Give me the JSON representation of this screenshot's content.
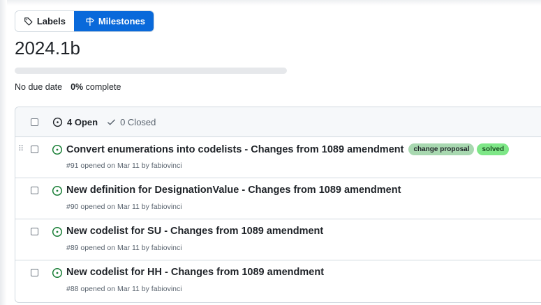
{
  "tabs": {
    "labels": "Labels",
    "milestones": "Milestones"
  },
  "milestone": {
    "title": "2024.1b",
    "due": "No due date",
    "percent": "0%",
    "complete_label": "complete",
    "progress_fraction": 0
  },
  "issues_header": {
    "open": "4 Open",
    "closed": "0 Closed"
  },
  "issues": [
    {
      "title": "Convert enumerations into codelists - Changes from 1089 amendment",
      "meta": "#91 opened on Mar 11 by fabiovinci",
      "labels": [
        {
          "name": "change proposal",
          "bg": "#a8d8b0",
          "fg": "#1f2328"
        },
        {
          "name": "solved",
          "bg": "#7ee787",
          "fg": "#1a4d21"
        }
      ]
    },
    {
      "title": "New definition for DesignationValue - Changes from 1089 amendment",
      "meta": "#90 opened on Mar 11 by fabiovinci",
      "labels": []
    },
    {
      "title": "New codelist for SU - Changes from 1089 amendment",
      "meta": "#89 opened on Mar 11 by fabiovinci",
      "labels": []
    },
    {
      "title": "New codelist for HH - Changes from 1089 amendment",
      "meta": "#88 opened on Mar 11 by fabiovinci",
      "labels": []
    }
  ],
  "colors": {
    "accent": "#0969da",
    "open_icon": "#1a7f37"
  },
  "icons": {
    "labels_tab": "tag-icon",
    "milestones_tab": "milestone-icon",
    "open": "issue-opened-icon",
    "closed": "check-icon",
    "drag": "grabber-icon"
  }
}
